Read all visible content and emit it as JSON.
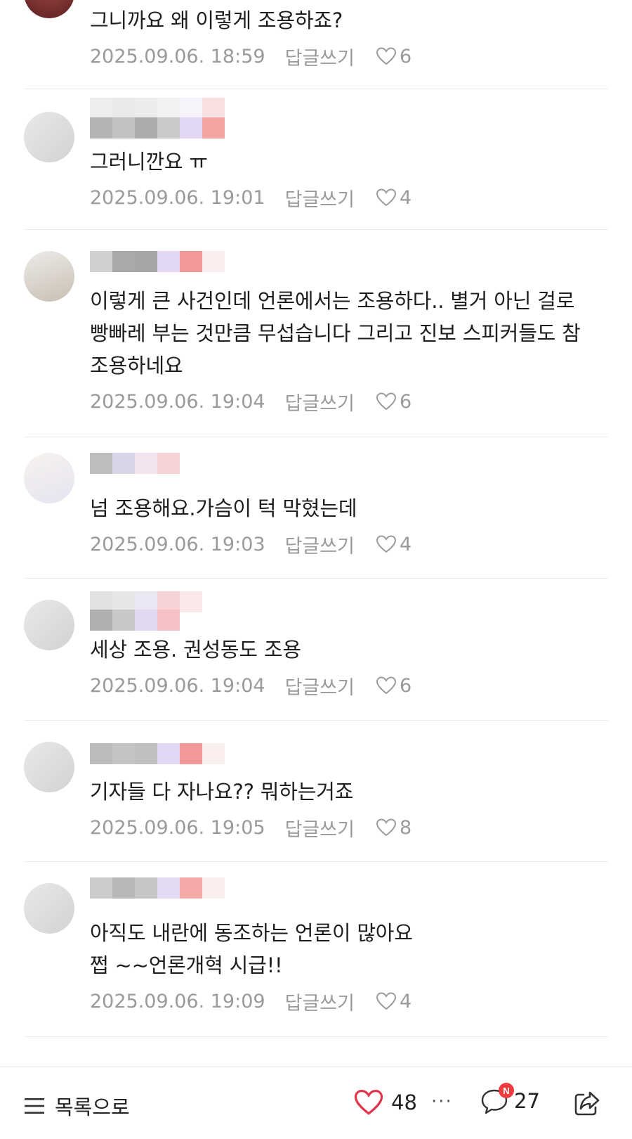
{
  "comments": [
    {
      "text": "그니까요 왜 이렇게 조용하죠?",
      "date": "2025.09.06. 18:59",
      "reply": "답글쓰기",
      "likes": "6"
    },
    {
      "text": "그러니깐요 ㅠ",
      "date": "2025.09.06. 19:01",
      "reply": "답글쓰기",
      "likes": "4"
    },
    {
      "text": "이렇게 큰 사건인데 언론에서는 조용하다.. 별거 아닌 걸로 빵빠레 부는 것만큼 무섭습니다 그리고 진보 스피커들도 참 조용하네요",
      "date": "2025.09.06. 19:04",
      "reply": "답글쓰기",
      "likes": "6"
    },
    {
      "text": "넘 조용해요.가슴이 턱 막혔는데",
      "date": "2025.09.06. 19:03",
      "reply": "답글쓰기",
      "likes": "4"
    },
    {
      "text": "세상 조용. 권성동도 조용",
      "date": "2025.09.06. 19:04",
      "reply": "답글쓰기",
      "likes": "6"
    },
    {
      "text": "기자들 다 자나요?? 뭐하는거죠",
      "date": "2025.09.06. 19:05",
      "reply": "답글쓰기",
      "likes": "8"
    },
    {
      "text_lines": [
        "아직도 내란에 동조하는 언론이 많아요",
        "쩝 ~~언론개혁 시급!!"
      ],
      "date": "2025.09.06. 19:09",
      "reply": "답글쓰기",
      "likes": "4"
    }
  ],
  "bottom_bar": {
    "list_label": "목록으로",
    "likes": "48",
    "more": "···",
    "comments": "27",
    "badge": "N",
    "icons": [
      "list-icon",
      "heart-icon",
      "more-icon",
      "comment-icon",
      "share-icon"
    ]
  },
  "colors": {
    "meta": "#9a9a9a",
    "heart": "#e0344a",
    "badge": "#ef3b3b"
  }
}
